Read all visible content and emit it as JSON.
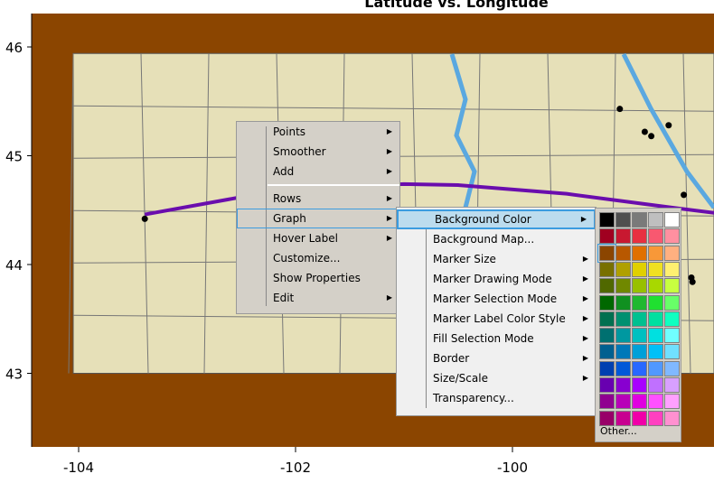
{
  "chart_data": {
    "type": "scatter",
    "title": "Latitude vs. Longitude",
    "xlim": [
      -104.4,
      -98.1
    ],
    "ylim": [
      42.35,
      46.3
    ],
    "x_ticks": [
      "-104",
      "-102",
      "-100"
    ],
    "x_tick_values": [
      -104,
      -102,
      -100
    ],
    "y_ticks": [
      "46",
      "45",
      "44",
      "43"
    ],
    "y_tick_values": [
      46,
      45,
      44,
      43
    ],
    "points": [
      {
        "x": -103.39,
        "y": 44.42
      },
      {
        "x": -99.01,
        "y": 45.43
      },
      {
        "x": -98.78,
        "y": 45.22
      },
      {
        "x": -98.72,
        "y": 45.18
      },
      {
        "x": -98.56,
        "y": 45.28
      },
      {
        "x": -98.42,
        "y": 44.64
      },
      {
        "x": -98.35,
        "y": 43.88
      },
      {
        "x": -98.34,
        "y": 43.84
      }
    ],
    "smoother": {
      "color": "#6a0dad",
      "x": [
        -103.39,
        -102.5,
        -101.5,
        -101,
        -100.5,
        -99.5,
        -98.5,
        -98.1
      ],
      "y": [
        44.46,
        44.62,
        44.72,
        44.74,
        44.73,
        44.65,
        44.52,
        44.47
      ]
    },
    "background_map": true,
    "outside_color": "#8b4500",
    "map_color": "#e6e0b8"
  },
  "context_menu": {
    "items": [
      {
        "label": "Points",
        "submenu": true
      },
      {
        "label": "Smoother",
        "submenu": true
      },
      {
        "label": "Add",
        "submenu": true
      },
      {
        "separator": true
      },
      {
        "label": "Rows",
        "submenu": true
      },
      {
        "label": "Graph",
        "submenu": true,
        "highlighted": true
      },
      {
        "label": "Hover Label",
        "submenu": true
      },
      {
        "label": "Customize...",
        "submenu": false
      },
      {
        "label": "Show Properties",
        "submenu": false
      },
      {
        "label": "Edit",
        "submenu": true
      }
    ]
  },
  "graph_submenu": {
    "items": [
      {
        "label": "Background Color",
        "submenu": true,
        "highlighted": true
      },
      {
        "label": "Background Map...",
        "submenu": false
      },
      {
        "label": "Marker Size",
        "submenu": true
      },
      {
        "label": "Marker Drawing Mode",
        "submenu": true
      },
      {
        "label": "Marker Selection Mode",
        "submenu": true
      },
      {
        "label": "Marker Label Color Style",
        "submenu": true
      },
      {
        "label": "Fill Selection Mode",
        "submenu": true
      },
      {
        "label": "Border",
        "submenu": true
      },
      {
        "label": "Size/Scale",
        "submenu": true
      },
      {
        "label": "Transparency...",
        "submenu": false
      }
    ]
  },
  "palette": {
    "selected": "#8b4500",
    "colors": [
      [
        "#000000",
        "#4f4f4f",
        "#7a7a7a",
        "#bfbfbf",
        "#ffffff"
      ],
      [
        "#a00020",
        "#c81830",
        "#e83040",
        "#f85870",
        "#ff90a0"
      ],
      [
        "#8b4500",
        "#b85800",
        "#e07000",
        "#f89838",
        "#ffb080"
      ],
      [
        "#787000",
        "#b0a000",
        "#e0d000",
        "#f0e020",
        "#fff070"
      ],
      [
        "#506800",
        "#708800",
        "#98c000",
        "#a8d800",
        "#c8ff40"
      ],
      [
        "#006800",
        "#109020",
        "#20b830",
        "#20e030",
        "#68ff68"
      ],
      [
        "#007050",
        "#009070",
        "#00c090",
        "#00e0a0",
        "#10ffc0"
      ],
      [
        "#007070",
        "#0098a0",
        "#00c0c0",
        "#00e0e0",
        "#70ffff"
      ],
      [
        "#006090",
        "#0078b8",
        "#00a0d8",
        "#00c0f8",
        "#70e0ff"
      ],
      [
        "#0040b0",
        "#0058d8",
        "#2868ff",
        "#5098ff",
        "#80b8ff"
      ],
      [
        "#6800b0",
        "#8800d0",
        "#a800ff",
        "#c070ff",
        "#d8a0ff"
      ],
      [
        "#900090",
        "#b800b8",
        "#e000e0",
        "#ff50ff",
        "#ffa0ff"
      ],
      [
        "#980068",
        "#c80090",
        "#f000a8",
        "#ff40c0",
        "#ff90d0"
      ]
    ],
    "other_label": "Other..."
  }
}
